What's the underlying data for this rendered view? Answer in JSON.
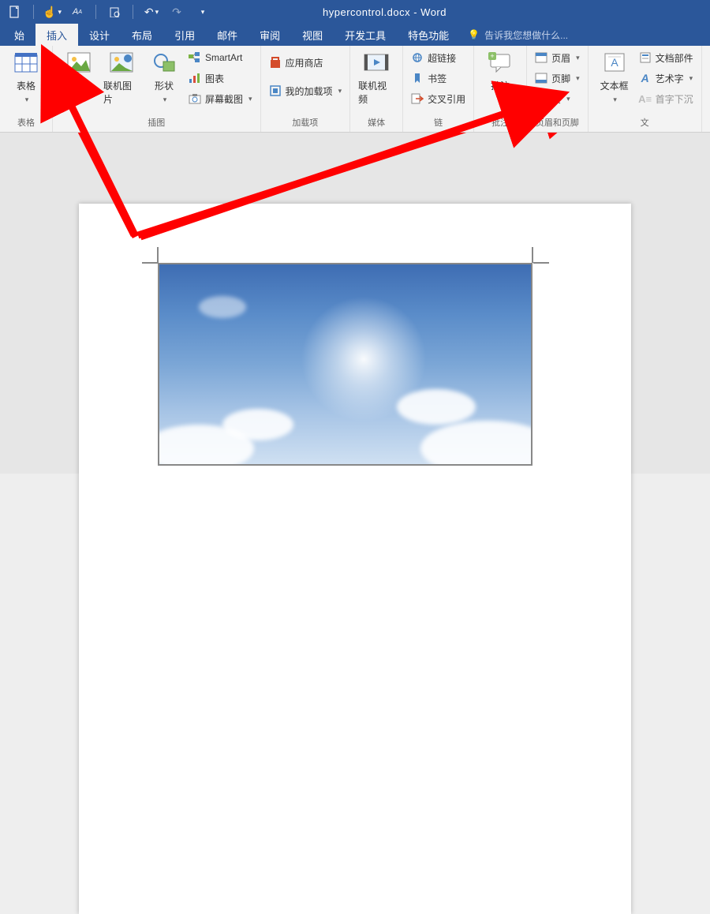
{
  "title": "hypercontrol.docx - Word",
  "tabs": [
    "始",
    "插入",
    "设计",
    "布局",
    "引用",
    "邮件",
    "审阅",
    "视图",
    "开发工具",
    "特色功能"
  ],
  "active_tab_index": 1,
  "tell_me": "告诉我您想做什么...",
  "group_labels": {
    "tables": "表格",
    "illustrations": "插图",
    "addins": "加载项",
    "media": "媒体",
    "links": "链",
    "comments": "批注",
    "header_footer": "页眉和页脚",
    "text": "文"
  },
  "btn": {
    "table": "表格",
    "picture": "图片",
    "online_pic": "联机图片",
    "shapes": "形状",
    "smartart": "SmartArt",
    "chart": "图表",
    "screenshot": "屏幕截图",
    "store": "应用商店",
    "myaddins": "我的加载项",
    "online_video": "联机视频",
    "hyperlink": "超链接",
    "bookmark": "书签",
    "crossref": "交叉引用",
    "comment": "批注",
    "header": "页眉",
    "footer": "页脚",
    "pagenum": "页",
    "textbox": "文本框",
    "quickparts": "文档部件",
    "wordart": "艺术字",
    "dropcap": "首字下沉"
  }
}
